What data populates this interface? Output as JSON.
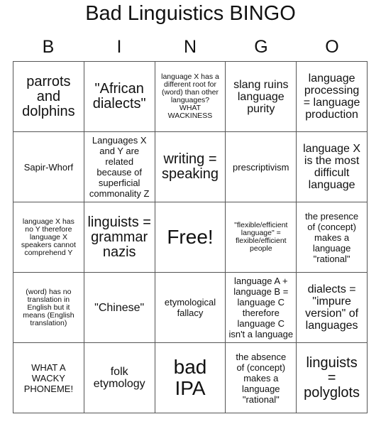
{
  "title": "Bad Linguistics BINGO",
  "letters": [
    "B",
    "I",
    "N",
    "G",
    "O"
  ],
  "cells": [
    "parrots\nand\ndolphins",
    "\"African\ndialects\"",
    "language X has a\ndifferent root for\n(word) than other\nlanguages?\nWHAT\nWACKINESS",
    "slang ruins\nlanguage\npurity",
    "language\nprocessing\n= language\nproduction",
    "Sapir-Whorf",
    "Languages X\nand Y are\nrelated\nbecause of\nsuperficial\ncommonality Z",
    "writing =\nspeaking",
    "prescriptivism",
    "language X\nis the most\ndifficult\nlanguage",
    "language X has\nno Y therefore\nlanguage X\nspeakers cannot\ncomprehend Y",
    "linguists =\ngrammar\nnazis",
    "Free!",
    "\"flexible/efficient\nlanguage\" =\nflexible/efficient\npeople",
    "the presence\nof (concept)\nmakes a\nlanguage\n\"rational\"",
    "(word) has no\ntranslation in\nEnglish but it\nmeans (English\ntranslation)",
    "\"Chinese\"",
    "etymological\nfallacy",
    "language A +\nlanguage B =\nlanguage C\ntherefore\nlanguage C\nisn't a language",
    "dialects =\n\"impure\nversion\" of\nlanguages",
    "WHAT A\nWACKY\nPHONEME!",
    "folk\netymology",
    "bad\nIPA",
    "the absence\nof (concept)\nmakes a\nlanguage\n\"rational\"",
    "linguists\n=\npolyglots"
  ]
}
